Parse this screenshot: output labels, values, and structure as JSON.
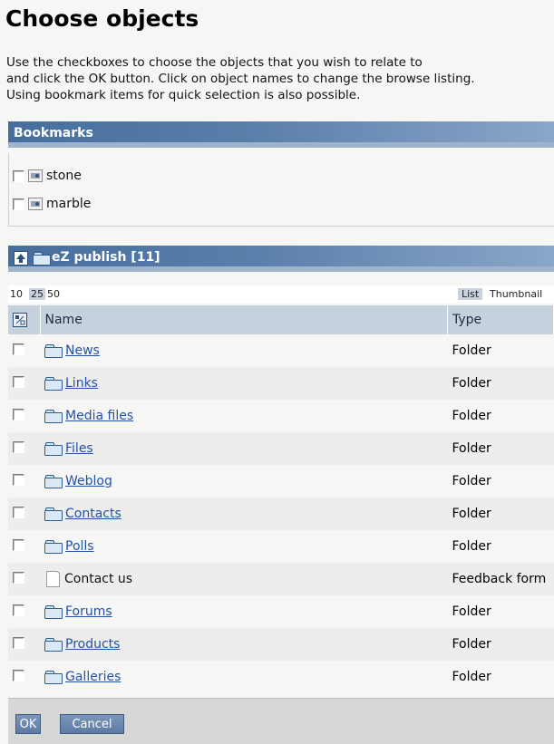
{
  "page": {
    "title": "Choose objects",
    "intro": [
      "Use the checkboxes to choose the objects that you wish to relate to",
      "and click the OK button. Click on object names to change the browse listing.",
      "Using bookmark items for quick selection is also possible."
    ]
  },
  "bookmarks": {
    "header": "Bookmarks",
    "items": [
      {
        "label": "stone",
        "icon": "image-icon"
      },
      {
        "label": "marble",
        "icon": "image-icon"
      }
    ]
  },
  "browse": {
    "header": "eZ publish [11]",
    "pager": {
      "limits": [
        "10",
        "25",
        "50"
      ],
      "selected_limit": "25",
      "view_list": "List",
      "view_thumbnail": "Thumbnail"
    },
    "columns": {
      "name": "Name",
      "type": "Type"
    },
    "rows": [
      {
        "name": "News",
        "type": "Folder",
        "icon": "folder-icon",
        "link": true
      },
      {
        "name": "Links",
        "type": "Folder",
        "icon": "folder-icon",
        "link": true
      },
      {
        "name": "Media files",
        "type": "Folder",
        "icon": "folder-icon",
        "link": true
      },
      {
        "name": "Files",
        "type": "Folder",
        "icon": "folder-icon",
        "link": true
      },
      {
        "name": "Weblog",
        "type": "Folder",
        "icon": "folder-icon",
        "link": true
      },
      {
        "name": "Contacts",
        "type": "Folder",
        "icon": "folder-icon",
        "link": true
      },
      {
        "name": "Polls",
        "type": "Folder",
        "icon": "folder-icon",
        "link": true
      },
      {
        "name": "Contact us",
        "type": "Feedback form",
        "icon": "document-icon",
        "link": false
      },
      {
        "name": "Forums",
        "type": "Folder",
        "icon": "folder-icon",
        "link": true
      },
      {
        "name": "Products",
        "type": "Folder",
        "icon": "folder-icon",
        "link": true
      },
      {
        "name": "Galleries",
        "type": "Folder",
        "icon": "folder-icon",
        "link": true
      }
    ]
  },
  "footer": {
    "ok_label": "OK",
    "cancel_label": "Cancel"
  },
  "colors": {
    "header_gradient_start": "#466e9d",
    "header_gradient_end": "#8aa6c8",
    "link": "#2452a6",
    "button": "#6e88ae"
  }
}
